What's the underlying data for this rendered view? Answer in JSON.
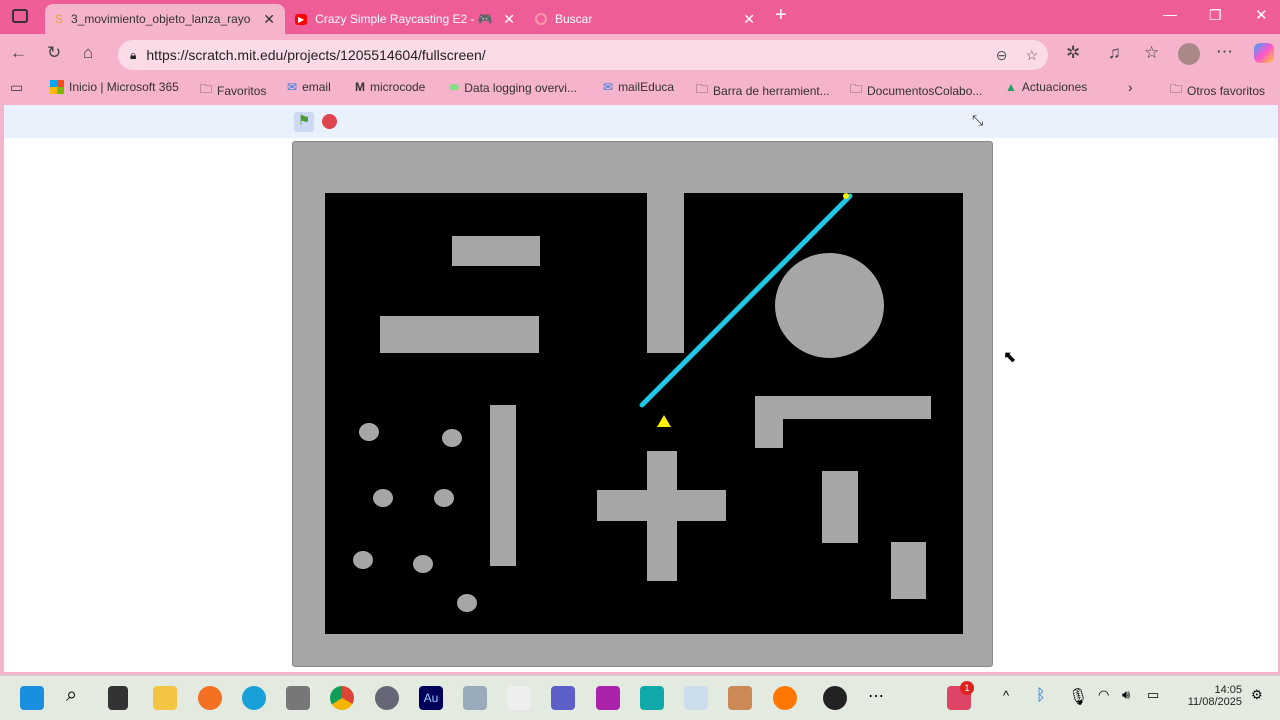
{
  "browser": {
    "tabs": [
      {
        "title": "3_movimiento_objeto_lanza_rayo",
        "active": true
      },
      {
        "title": "Crazy Simple Raycasting E2 - 🎮",
        "active": false
      },
      {
        "title": "Buscar",
        "active": false
      }
    ],
    "url": "https://scratch.mit.edu/projects/1205514604/fullscreen/",
    "bookmarks": [
      "Inicio | Microsoft 365",
      "Favoritos",
      "email",
      "microcode",
      "Data logging overvi...",
      "mailEduca",
      "Barra de herramient...",
      "DocumentosColabo...",
      "Actuaciones"
    ],
    "other_bookmarks": "Otros favoritos"
  },
  "scratch": {
    "green_flag": "green-flag",
    "stop": "stop",
    "fullscreen_exit": "exit-fullscreen"
  },
  "colors": {
    "ray": "#1ec8e6",
    "player": "#ffee00",
    "wall": "#a6a6a6"
  },
  "taskbar": {
    "time": "14:05",
    "date": "11/08/2025",
    "notification_count": "1"
  }
}
